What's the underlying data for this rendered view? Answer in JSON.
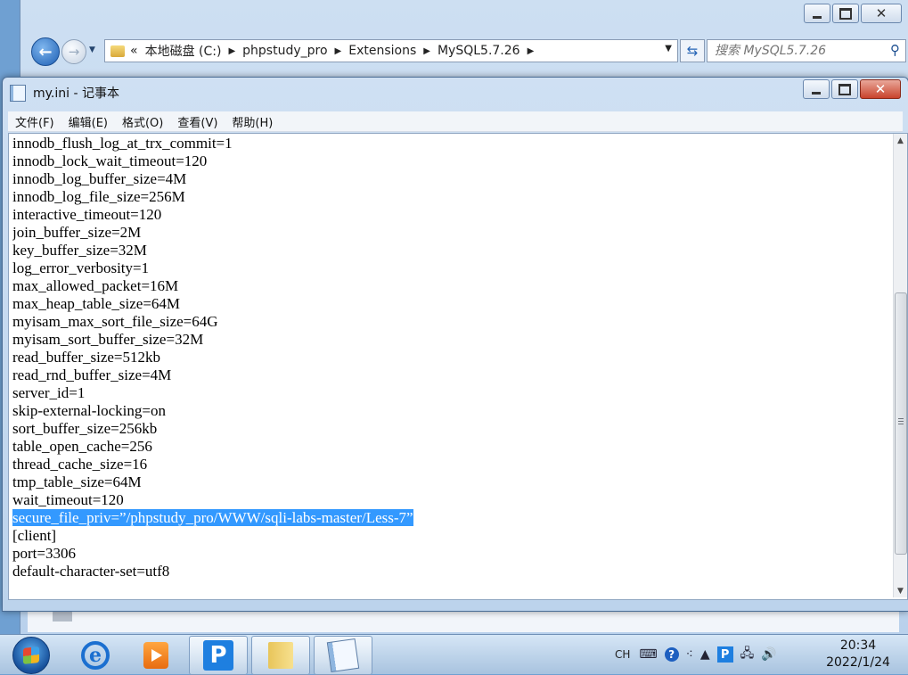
{
  "explorer": {
    "address_segments": [
      "«",
      "本地磁盘 (C:)",
      "phpstudy_pro",
      "Extensions",
      "MySQL5.7.26"
    ],
    "search_placeholder": "搜索 MySQL5.7.26"
  },
  "notepad": {
    "title": "my.ini - 记事本",
    "menu": [
      "文件(F)",
      "编辑(E)",
      "格式(O)",
      "查看(V)",
      "帮助(H)"
    ],
    "lines": [
      "innodb_flush_log_at_trx_commit=1",
      "innodb_lock_wait_timeout=120",
      "innodb_log_buffer_size=4M",
      "innodb_log_file_size=256M",
      "interactive_timeout=120",
      "join_buffer_size=2M",
      "key_buffer_size=32M",
      "log_error_verbosity=1",
      "max_allowed_packet=16M",
      "max_heap_table_size=64M",
      "myisam_max_sort_file_size=64G",
      "myisam_sort_buffer_size=32M",
      "read_buffer_size=512kb",
      "read_rnd_buffer_size=4M",
      "server_id=1",
      "skip-external-locking=on",
      "sort_buffer_size=256kb",
      "table_open_cache=256",
      "thread_cache_size=16",
      "tmp_table_size=64M",
      "wait_timeout=120",
      "secure_file_priv=”/phpstudy_pro/WWW/sqli-labs-master/Less-7”",
      "[client]",
      "port=3306",
      "default-character-set=utf8"
    ],
    "selected_line_index": 21,
    "selection_color": "#3399ff"
  },
  "taskbar": {
    "tray_language": "CH",
    "tray_pinned_app": "P",
    "pinned_app_label": "P",
    "clock_time": "20:34",
    "clock_date": "2022/1/24"
  }
}
